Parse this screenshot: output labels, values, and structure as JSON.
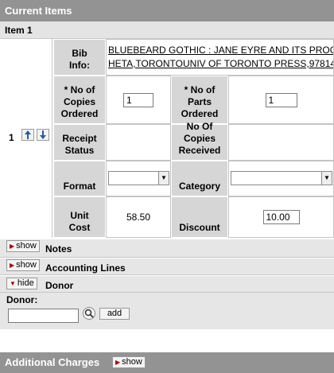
{
  "section_title": "Current Items",
  "item_title": "Item 1",
  "row_number": "1",
  "bib_info_label": "Bib Info:",
  "bib_info_line1": "BLUEBEARD GOTHIC : JANE EYRE AND ITS PROG",
  "bib_info_line2": "HETA,TORONTOUNIV OF TORONTO PRESS,97814",
  "copies_ordered_label": "* No of Copies Ordered",
  "copies_ordered_value": "1",
  "parts_ordered_label": "* No of Parts Ordered",
  "parts_ordered_value": "1",
  "receipt_status_label": "Receipt Status",
  "copies_received_label": "No Of Copies Received",
  "format_label": "Format",
  "category_label": "Category",
  "unit_cost_label": "Unit Cost",
  "unit_cost_value": "58.50",
  "discount_label": "Discount",
  "discount_value": "10.00",
  "notes": {
    "button": "show",
    "title": "Notes"
  },
  "accounting": {
    "button": "show",
    "title": "Accounting Lines"
  },
  "donor": {
    "button": "hide",
    "title": "Donor",
    "field_label": "Donor:",
    "add_label": "add"
  },
  "additional_charges": {
    "title": "Additional Charges",
    "button": "show"
  },
  "icons": {
    "move_up": "arrow-up-icon",
    "move_down": "arrow-down-icon",
    "lookup": "magnifier-icon",
    "toggle": "triangle-icon"
  }
}
